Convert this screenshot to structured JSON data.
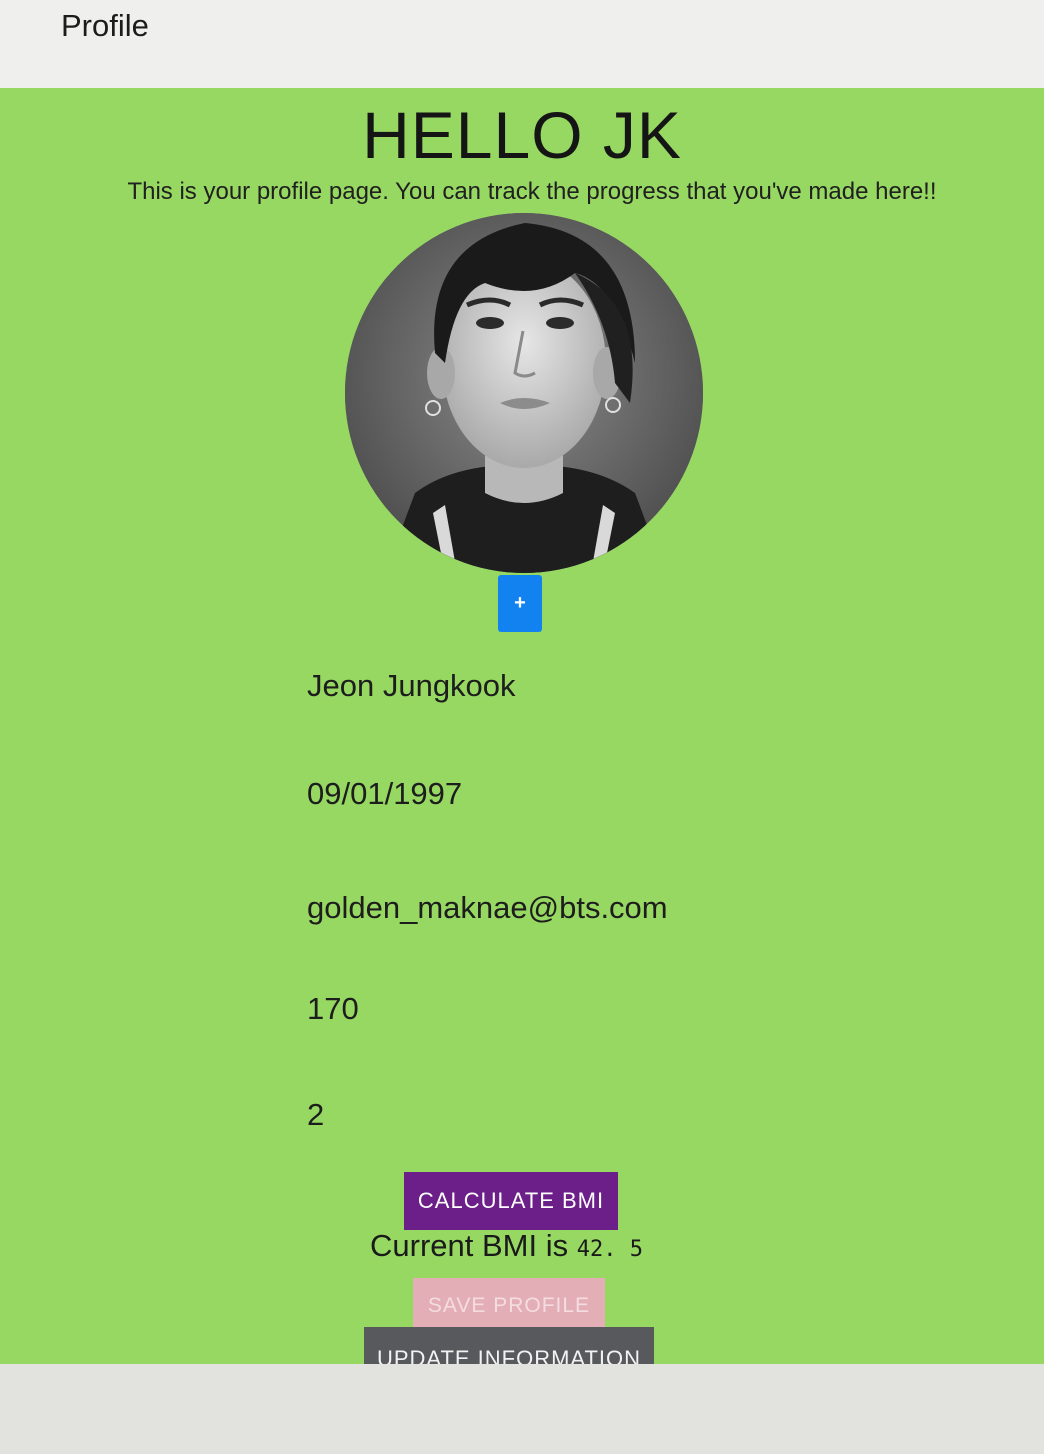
{
  "header": {
    "title": "Profile"
  },
  "profile": {
    "greeting": "HELLO JK",
    "intro": "This is your profile page. You can track the progress that you've made here!!",
    "add_photo_label": "+",
    "name": "Jeon Jungkook",
    "birthdate": "09/01/1997",
    "email": "golden_maknae@bts.com",
    "height": "170",
    "weight": "2"
  },
  "bmi": {
    "button_label": "CALCULATE BMI",
    "prefix": "Current BMI is",
    "value": "42. 5"
  },
  "actions": {
    "save_label": "SAVE PROFILE",
    "update_label": "UPDATE INFORMATION"
  },
  "colors": {
    "page_background": "#96d862",
    "add_photo_button": "#1282f1",
    "calculate_button": "#6c1f88",
    "save_button": "#e3aeb5",
    "update_button": "#58595c"
  }
}
